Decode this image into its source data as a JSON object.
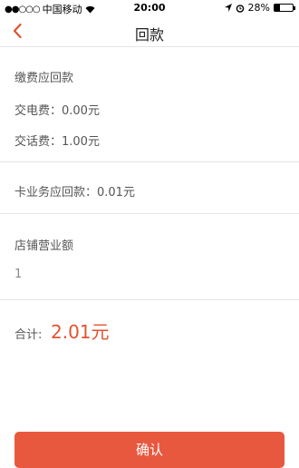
{
  "status_bar": {
    "carrier": "中国移动",
    "time": "20:00",
    "battery": "28%",
    "battery_level": 0.28
  },
  "nav": {
    "title": "回款",
    "back_icon": "chevron-left-icon"
  },
  "payment": {
    "heading": "缴费应回款",
    "electric": "交电费：0.00元",
    "phone": "交话费：1.00元"
  },
  "card": {
    "label": "卡业务应回款：0.01元"
  },
  "store": {
    "heading": "店铺营业额",
    "value": "1"
  },
  "total": {
    "label": "合计:",
    "value": "2.01元"
  },
  "confirm_label": "确认",
  "colors": {
    "accent": "#e0532f",
    "button": "#e8583f"
  }
}
